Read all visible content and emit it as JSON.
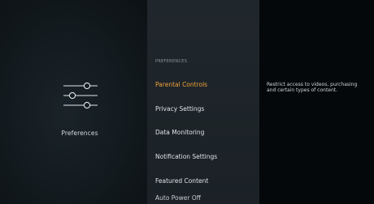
{
  "category": {
    "label": "Preferences",
    "icon": "sliders-icon"
  },
  "menu": {
    "section_header": "PREFERENCES",
    "items": [
      {
        "label": "Parental Controls",
        "selected": true
      },
      {
        "label": "Privacy Settings",
        "selected": false
      },
      {
        "label": "Data Monitoring",
        "selected": false
      },
      {
        "label": "Notification Settings",
        "selected": false
      },
      {
        "label": "Featured Content",
        "selected": false
      },
      {
        "label": "Auto Power Off",
        "selected": false
      }
    ]
  },
  "description": {
    "text": "Restrict access to videos, purchasing and certain types of content."
  },
  "colors": {
    "accent": "#f0a13a",
    "menu_background": "#1c2328",
    "description_background": "#05080a"
  }
}
